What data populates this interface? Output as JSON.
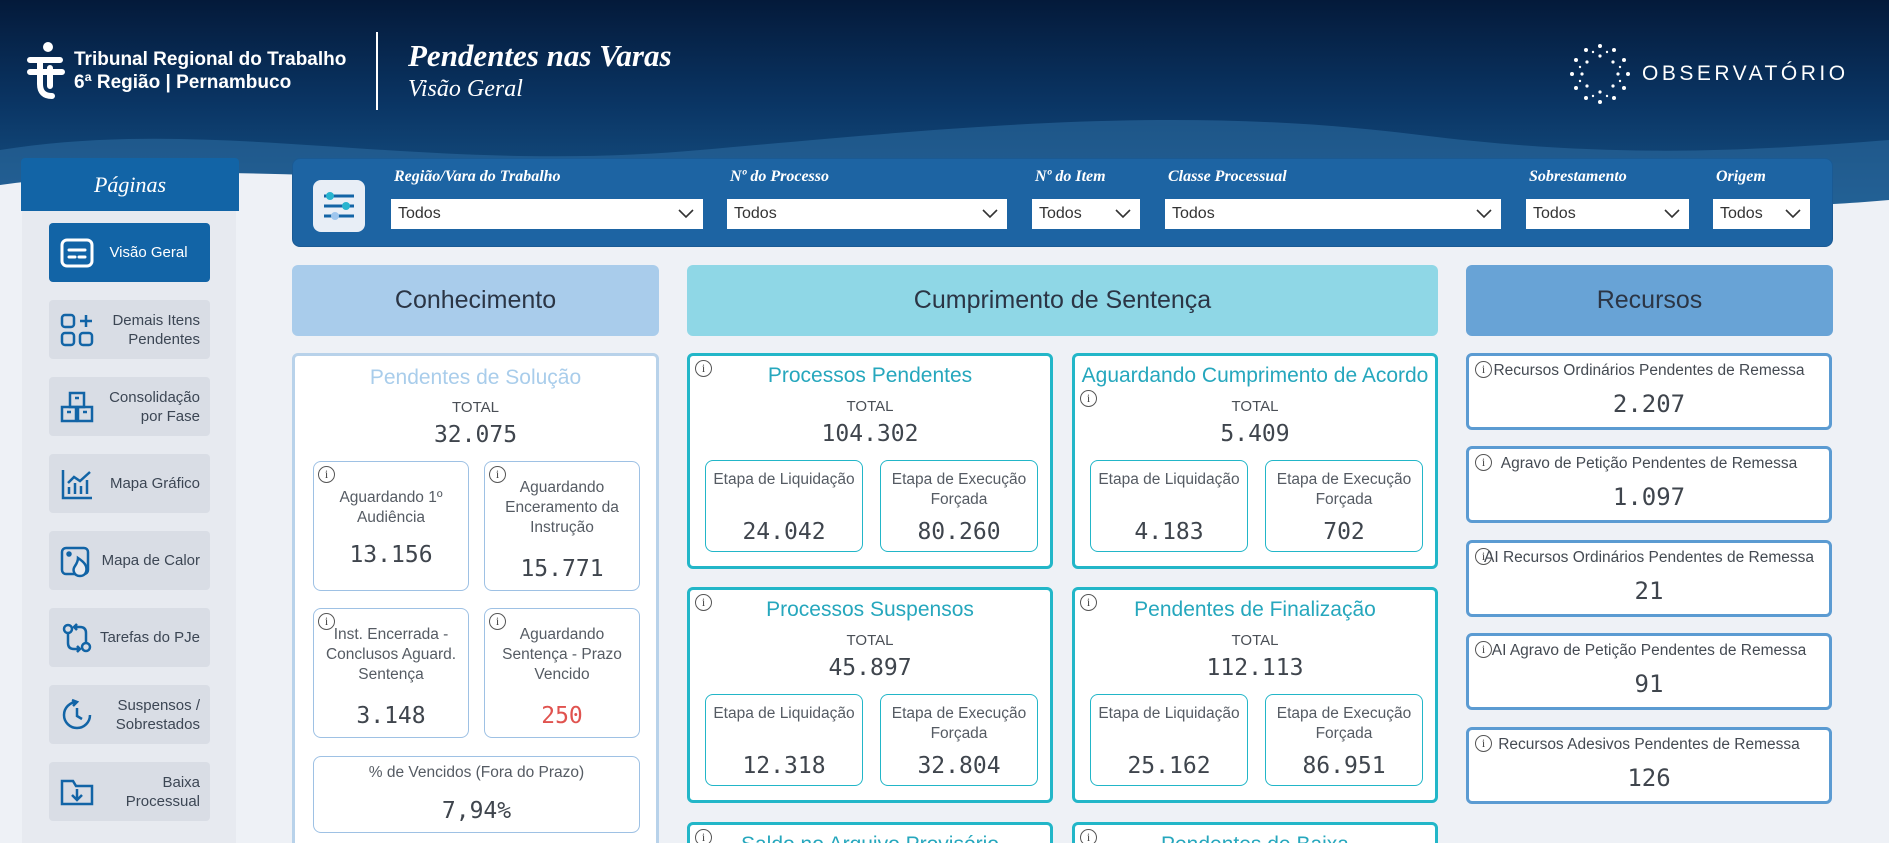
{
  "header": {
    "org_line1": "Tribunal Regional do Trabalho",
    "org_line2": "6ª Região | Pernambuco",
    "title": "Pendentes nas Varas",
    "subtitle": "Visão Geral",
    "brand": "OBSERVATÓRIO"
  },
  "sidebar": {
    "title": "Páginas",
    "items": [
      {
        "label": "Visão Geral",
        "icon": "dashboard-icon"
      },
      {
        "label": "Demais Itens Pendentes",
        "icon": "add-grid-icon"
      },
      {
        "label": "Consolidação por Fase",
        "icon": "boxes-icon"
      },
      {
        "label": "Mapa Gráfico",
        "icon": "chart-icon"
      },
      {
        "label": "Mapa de Calor",
        "icon": "heat-map-icon"
      },
      {
        "label": "Tarefas do PJe",
        "icon": "workflow-icon"
      },
      {
        "label": "Suspensos / Sobrestados",
        "icon": "clock-icon"
      },
      {
        "label": "Baixa Processual",
        "icon": "folder-download-icon"
      }
    ]
  },
  "filters": [
    {
      "label": "Região/Vara do Trabalho",
      "value": "Todos"
    },
    {
      "label": "Nº do Processo",
      "value": "Todos"
    },
    {
      "label": "Nº do Item",
      "value": "Todos"
    },
    {
      "label": "Classe Processual",
      "value": "Todos"
    },
    {
      "label": "Sobrestamento",
      "value": "Todos"
    },
    {
      "label": "Origem",
      "value": "Todos"
    }
  ],
  "colors": {
    "accent": "#1264a6",
    "teal": "#22b6c8",
    "red": "#e0534f"
  },
  "sections": {
    "conhecimento": "Conhecimento",
    "cumprimento": "Cumprimento de Sentença",
    "recursos": "Recursos"
  },
  "conhecimento": {
    "title": "Pendentes de Solução",
    "total_label": "TOTAL",
    "total": "32.075",
    "items": [
      {
        "label": "Aguardando 1º Audiência",
        "value": "13.156"
      },
      {
        "label": "Aguardando Enceramento da Instrução",
        "value": "15.771"
      },
      {
        "label": "Inst. Encerrada - Conclusos Aguard. Sentença",
        "value": "3.148"
      },
      {
        "label": "Aguardando Sentença - Prazo Vencido",
        "value": "250"
      }
    ],
    "pct_label": "% de Vencidos (Fora do Prazo)",
    "pct_value": "7,94%"
  },
  "cumprimento": [
    {
      "title": "Processos Pendentes",
      "total_label": "TOTAL",
      "total": "104.302",
      "a_label": "Etapa de Liquidação",
      "a_value": "24.042",
      "b_label": "Etapa de Execução Forçada",
      "b_value": "80.260"
    },
    {
      "title": "Aguardando Cumprimento de Acordo",
      "total_label": "TOTAL",
      "total": "5.409",
      "a_label": "Etapa de Liquidação",
      "a_value": "4.183",
      "b_label": "Etapa de Execução Forçada",
      "b_value": "702"
    },
    {
      "title": "Processos Suspensos",
      "total_label": "TOTAL",
      "total": "45.897",
      "a_label": "Etapa de Liquidação",
      "a_value": "12.318",
      "b_label": "Etapa de Execução Forçada",
      "b_value": "32.804"
    },
    {
      "title": "Pendentes de Finalização",
      "total_label": "TOTAL",
      "total": "112.113",
      "a_label": "Etapa de Liquidação",
      "a_value": "25.162",
      "b_label": "Etapa de Execução Forçada",
      "b_value": "86.951"
    },
    {
      "title": "Saldo no Arquivo Provisório"
    },
    {
      "title": "Pendentes de Baixa"
    }
  ],
  "recursos": [
    {
      "label": "Recursos Ordinários Pendentes de Remessa",
      "value": "2.207"
    },
    {
      "label": "Agravo de Petição Pendentes de Remessa",
      "value": "1.097"
    },
    {
      "label": "AI Recursos Ordinários Pendentes de Remessa",
      "value": "21"
    },
    {
      "label": "AI Agravo de Petição Pendentes de Remessa",
      "value": "91"
    },
    {
      "label": "Recursos Adesivos Pendentes de Remessa",
      "value": "126"
    }
  ],
  "info_glyph": "i"
}
